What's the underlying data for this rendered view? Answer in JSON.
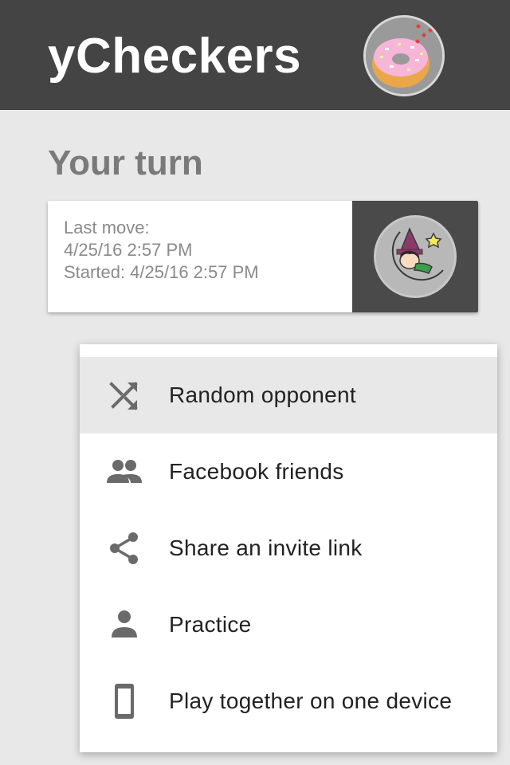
{
  "app": {
    "title": "yCheckers",
    "profile_avatar_icon": "donut-avatar-icon"
  },
  "section": {
    "title": "Your turn"
  },
  "game_card": {
    "last_move_label": "Last move:",
    "last_move_time": "4/25/16 2:57 PM",
    "started_text": "Started: 4/25/16 2:57 PM",
    "opponent_avatar_icon": "witch-on-moon-avatar-icon"
  },
  "menu": {
    "items": [
      {
        "label": "Random opponent",
        "icon": "shuffle-icon",
        "highlighted": true
      },
      {
        "label": "Facebook friends",
        "icon": "people-icon",
        "highlighted": false
      },
      {
        "label": "Share an invite link",
        "icon": "share-icon",
        "highlighted": false
      },
      {
        "label": "Practice",
        "icon": "person-icon",
        "highlighted": false
      },
      {
        "label": "Play together on one device",
        "icon": "phone-icon",
        "highlighted": false
      }
    ]
  },
  "colors": {
    "header_bg": "#444444",
    "page_bg": "#e8e8e8",
    "icon_gray": "#6a6a6a",
    "highlight_bg": "#e8e8e8"
  }
}
